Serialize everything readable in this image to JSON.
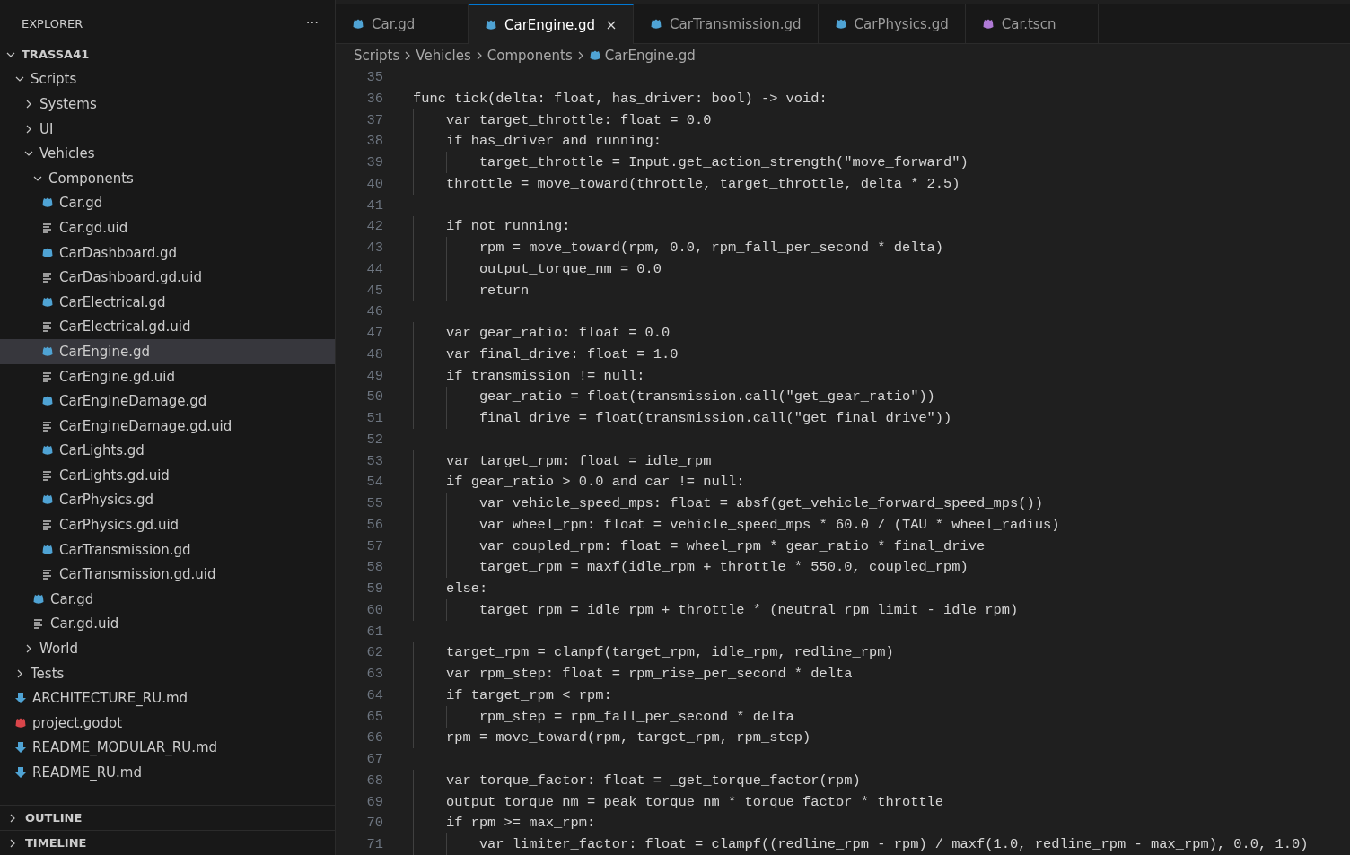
{
  "sidebar": {
    "title": "EXPLORER",
    "more_label": "···",
    "tree": [
      {
        "label": "TRASSA41",
        "kind": "root",
        "expanded": true,
        "selected": false,
        "children": [
          {
            "label": "Scripts",
            "kind": "folder",
            "expanded": true,
            "selected": false,
            "children": [
              {
                "label": "Systems",
                "kind": "folder",
                "expanded": false,
                "selected": false
              },
              {
                "label": "UI",
                "kind": "folder",
                "expanded": false,
                "selected": false
              },
              {
                "label": "Vehicles",
                "kind": "folder",
                "expanded": true,
                "selected": false,
                "children": [
                  {
                    "label": "Components",
                    "kind": "folder",
                    "expanded": true,
                    "selected": false,
                    "children": [
                      {
                        "label": "Car.gd",
                        "kind": "gdscript",
                        "selected": false
                      },
                      {
                        "label": "Car.gd.uid",
                        "kind": "uid",
                        "selected": false
                      },
                      {
                        "label": "CarDashboard.gd",
                        "kind": "gdscript",
                        "selected": false
                      },
                      {
                        "label": "CarDashboard.gd.uid",
                        "kind": "uid",
                        "selected": false
                      },
                      {
                        "label": "CarElectrical.gd",
                        "kind": "gdscript",
                        "selected": false
                      },
                      {
                        "label": "CarElectrical.gd.uid",
                        "kind": "uid",
                        "selected": false
                      },
                      {
                        "label": "CarEngine.gd",
                        "kind": "gdscript",
                        "selected": true
                      },
                      {
                        "label": "CarEngine.gd.uid",
                        "kind": "uid",
                        "selected": false
                      },
                      {
                        "label": "CarEngineDamage.gd",
                        "kind": "gdscript",
                        "selected": false
                      },
                      {
                        "label": "CarEngineDamage.gd.uid",
                        "kind": "uid",
                        "selected": false
                      },
                      {
                        "label": "CarLights.gd",
                        "kind": "gdscript",
                        "selected": false
                      },
                      {
                        "label": "CarLights.gd.uid",
                        "kind": "uid",
                        "selected": false
                      },
                      {
                        "label": "CarPhysics.gd",
                        "kind": "gdscript",
                        "selected": false
                      },
                      {
                        "label": "CarPhysics.gd.uid",
                        "kind": "uid",
                        "selected": false
                      },
                      {
                        "label": "CarTransmission.gd",
                        "kind": "gdscript",
                        "selected": false
                      },
                      {
                        "label": "CarTransmission.gd.uid",
                        "kind": "uid",
                        "selected": false
                      }
                    ]
                  },
                  {
                    "label": "Car.gd",
                    "kind": "gdscript",
                    "selected": false
                  },
                  {
                    "label": "Car.gd.uid",
                    "kind": "uid",
                    "selected": false
                  }
                ]
              },
              {
                "label": "World",
                "kind": "folder",
                "expanded": false,
                "selected": false
              }
            ]
          },
          {
            "label": "Tests",
            "kind": "folder",
            "expanded": false,
            "selected": false
          },
          {
            "label": "ARCHITECTURE_RU.md",
            "kind": "markdown",
            "selected": false
          },
          {
            "label": "project.godot",
            "kind": "project",
            "selected": false
          },
          {
            "label": "README_MODULAR_RU.md",
            "kind": "markdown",
            "selected": false
          },
          {
            "label": "README_RU.md",
            "kind": "markdown",
            "selected": false
          }
        ]
      }
    ],
    "sections": [
      {
        "label": "OUTLINE",
        "expanded": false
      },
      {
        "label": "TIMELINE",
        "expanded": false
      }
    ]
  },
  "tabs": [
    {
      "label": "Car.gd",
      "kind": "gdscript",
      "selected": false
    },
    {
      "label": "CarEngine.gd",
      "kind": "gdscript",
      "selected": true
    },
    {
      "label": "CarTransmission.gd",
      "kind": "gdscript",
      "selected": false
    },
    {
      "label": "CarPhysics.gd",
      "kind": "gdscript",
      "selected": false
    },
    {
      "label": "Car.tscn",
      "kind": "scene",
      "selected": false
    }
  ],
  "breadcrumb": [
    {
      "label": "Scripts",
      "kind": "folder"
    },
    {
      "label": "Vehicles",
      "kind": "folder"
    },
    {
      "label": "Components",
      "kind": "folder"
    },
    {
      "label": "CarEngine.gd",
      "kind": "gdscript"
    }
  ],
  "editor": {
    "lines": [
      {
        "number": "35"
      },
      {
        "number": "36",
        "text": "func tick(delta: float, has_driver: bool) -> void:"
      },
      {
        "number": "37",
        "text": "    var target_throttle: float = 0.0"
      },
      {
        "number": "38",
        "text": "    if has_driver and running:"
      },
      {
        "number": "39",
        "text": "        target_throttle = Input.get_action_strength(\"move_forward\")"
      },
      {
        "number": "40",
        "text": "    throttle = move_toward(throttle, target_throttle, delta * 2.5)"
      },
      {
        "number": "41"
      },
      {
        "number": "42",
        "text": "    if not running:"
      },
      {
        "number": "43",
        "text": "        rpm = move_toward(rpm, 0.0, rpm_fall_per_second * delta)"
      },
      {
        "number": "44",
        "text": "        output_torque_nm = 0.0"
      },
      {
        "number": "45",
        "text": "        return"
      },
      {
        "number": "46"
      },
      {
        "number": "47",
        "text": "    var gear_ratio: float = 0.0"
      },
      {
        "number": "48",
        "text": "    var final_drive: float = 1.0"
      },
      {
        "number": "49",
        "text": "    if transmission != null:"
      },
      {
        "number": "50",
        "text": "        gear_ratio = float(transmission.call(\"get_gear_ratio\"))"
      },
      {
        "number": "51",
        "text": "        final_drive = float(transmission.call(\"get_final_drive\"))"
      },
      {
        "number": "52"
      },
      {
        "number": "53",
        "text": "    var target_rpm: float = idle_rpm"
      },
      {
        "number": "54",
        "text": "    if gear_ratio > 0.0 and car != null:"
      },
      {
        "number": "55",
        "text": "        var vehicle_speed_mps: float = absf(get_vehicle_forward_speed_mps())"
      },
      {
        "number": "56",
        "text": "        var wheel_rpm: float = vehicle_speed_mps * 60.0 / (TAU * wheel_radius)"
      },
      {
        "number": "57",
        "text": "        var coupled_rpm: float = wheel_rpm * gear_ratio * final_drive"
      },
      {
        "number": "58",
        "text": "        target_rpm = maxf(idle_rpm + throttle * 550.0, coupled_rpm)"
      },
      {
        "number": "59",
        "text": "    else:"
      },
      {
        "number": "60",
        "text": "        target_rpm = idle_rpm + throttle * (neutral_rpm_limit - idle_rpm)"
      },
      {
        "number": "61"
      },
      {
        "number": "62",
        "text": "    target_rpm = clampf(target_rpm, idle_rpm, redline_rpm)"
      },
      {
        "number": "63",
        "text": "    var rpm_step: float = rpm_rise_per_second * delta"
      },
      {
        "number": "64",
        "text": "    if target_rpm < rpm:"
      },
      {
        "number": "65",
        "text": "        rpm_step = rpm_fall_per_second * delta"
      },
      {
        "number": "66",
        "text": "    rpm = move_toward(rpm, target_rpm, rpm_step)"
      },
      {
        "number": "67"
      },
      {
        "number": "68",
        "text": "    var torque_factor: float = _get_torque_factor(rpm)"
      },
      {
        "number": "69",
        "text": "    output_torque_nm = peak_torque_nm * torque_factor * throttle"
      },
      {
        "number": "70",
        "text": "    if rpm >= max_rpm:"
      },
      {
        "number": "71",
        "text": "        var limiter_factor: float = clampf((redline_rpm - rpm) / maxf(1.0, redline_rpm - max_rpm), 0.0, 1.0)"
      }
    ]
  }
}
